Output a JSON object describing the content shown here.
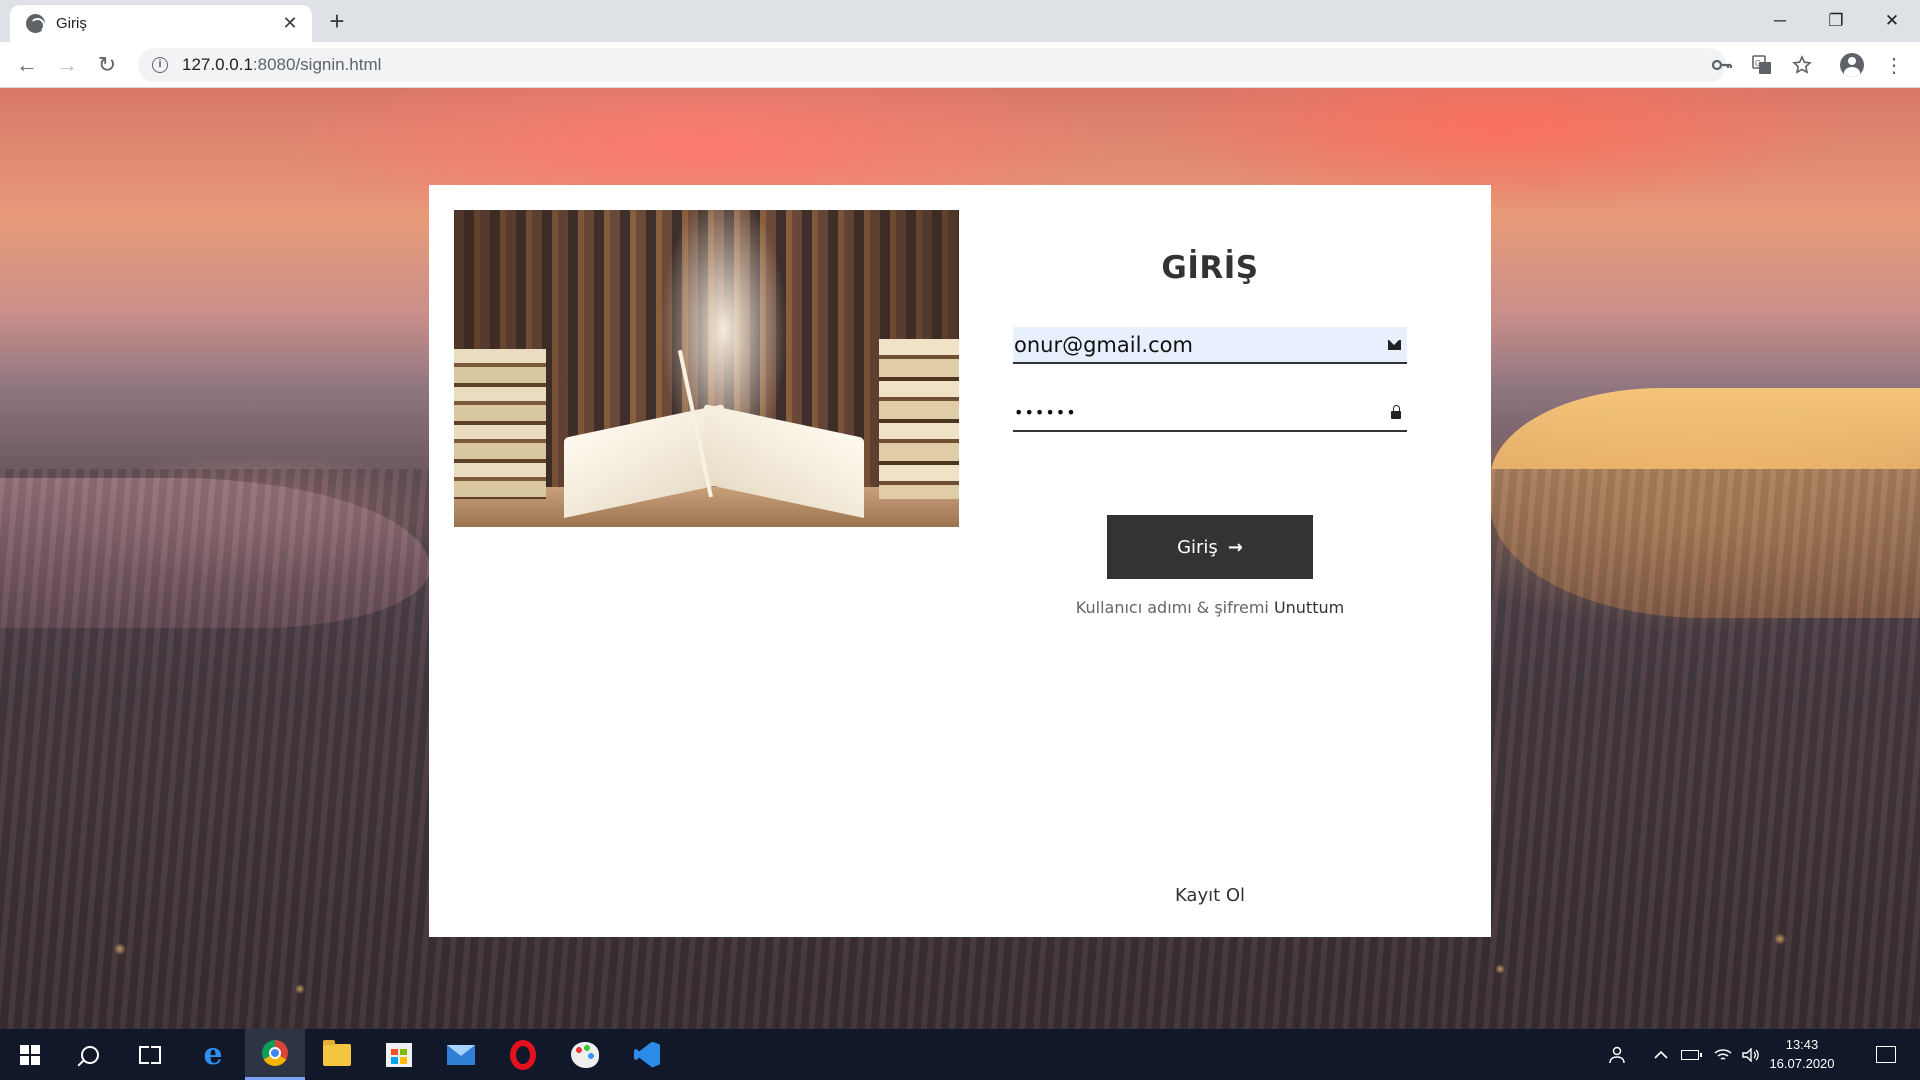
{
  "browser": {
    "tab_title": "Giriş",
    "tab_close": "✕",
    "new_tab": "+",
    "url_host": "127.0.0.1",
    "url_path": ":8080/signin.html",
    "window": {
      "minimize": "─",
      "maximize": "❐",
      "close": "✕"
    },
    "nav": {
      "back": "←",
      "forward": "→",
      "reload": "↻"
    },
    "toolbar_icons": [
      "key-icon",
      "translate-icon",
      "star-icon",
      "profile-icon",
      "menu-icon"
    ]
  },
  "login": {
    "title": "GİRİŞ",
    "email_value": "onur@gmail.com",
    "password_value": "••••••",
    "submit_label": "Giriş",
    "submit_arrow": "→",
    "forgot_text": "Kullanıcı adımı & şifremi",
    "forgot_link": "Unuttum",
    "signup_label": "Kayıt Ol"
  },
  "taskbar": {
    "apps": [
      "start-icon",
      "search-icon",
      "task-view-icon",
      "edge-icon",
      "chrome-icon",
      "file-explorer-icon",
      "store-icon",
      "mail-icon",
      "opera-icon",
      "paint-icon",
      "vscode-icon"
    ],
    "active_app": "chrome-icon",
    "time": "13:43",
    "date": "16.07.2020"
  },
  "colors": {
    "button_bg": "#333333",
    "email_field_bg": "#e8f0fe",
    "taskbar_bg": "#10182a"
  }
}
